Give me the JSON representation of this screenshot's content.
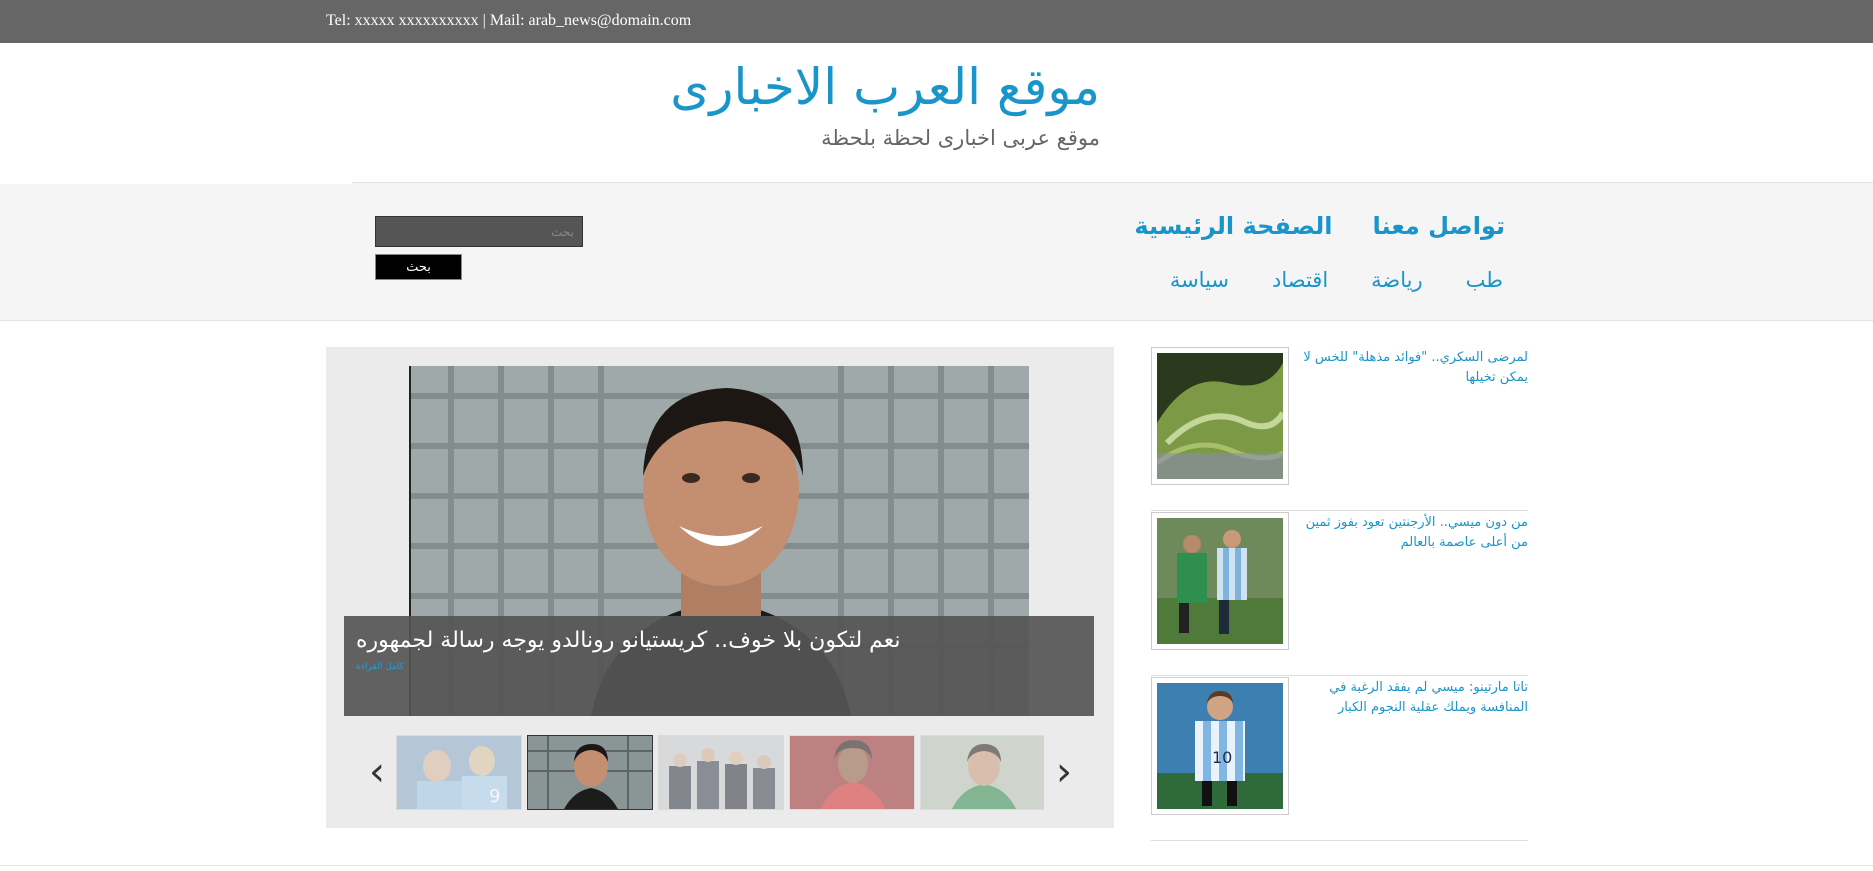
{
  "topbar": {
    "contact": "Tel: xxxxx xxxxxxxxxx | Mail: arab_news@domain.com"
  },
  "header": {
    "title": "موقع العرب الاخبارى",
    "tagline": "موقع عربى اخبارى لحظة بلحظة"
  },
  "nav": {
    "primary": [
      {
        "label": "الصفحة الرئيسية"
      },
      {
        "label": "تواصل معنا"
      }
    ],
    "categories": [
      {
        "label": "سياسة"
      },
      {
        "label": "اقتصاد"
      },
      {
        "label": "رياضة"
      },
      {
        "label": "طب"
      }
    ]
  },
  "search": {
    "placeholder": "بحث",
    "button_label": "بحث"
  },
  "slider": {
    "caption_title": "نعم لتكون بلا خوف.. كريستيانو رونالدو يوجه رسالة لجمهوره",
    "caption_more": "كامل القراءة",
    "prev_icon": "chevron-left-icon",
    "next_icon": "chevron-right-icon",
    "prev_glyph": "‹",
    "next_glyph": "›",
    "active_thumb": 2
  },
  "news": [
    {
      "title": "لمرضى السكري.. \"فوائد مذهلة\" للخس لا يمكن تخيلها"
    },
    {
      "title": "من دون ميسي.. الأرجنتين تعود بفوز ثمين من أعلى عاصمة بالعالم"
    },
    {
      "title": "تاتا مارتينو: ميسي لم يفقد الرغبة في المنافسة ويملك عقلية النجوم الكبار"
    }
  ],
  "colors": {
    "accent": "#1a95c9",
    "topbar_bg": "#666666",
    "nav_bg": "#f5f5f5",
    "slider_bg": "#ebebeb"
  }
}
